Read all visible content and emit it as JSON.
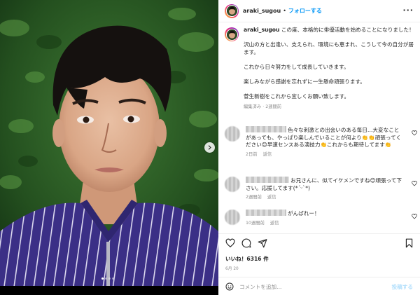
{
  "header": {
    "username": "araki_sugou",
    "separator": "•",
    "follow_label": "フォローする"
  },
  "caption": {
    "username": "araki_sugou",
    "paragraphs": [
      "この度、本格的に俳優活動を始めることになりました！",
      "沢山の方と出逢い、支えられ、環境にも恵まれ、こうして今の自分が居ます。",
      "これから日々努力をして成長していきます。",
      "楽しみながら感謝を忘れずに一生懸命頑張ります。",
      "菅生新樹をこれから宜しくお願い致します。"
    ],
    "meta": "編集済み · 2週間前"
  },
  "comments": [
    {
      "text": "色々な刺激との出会いのある毎日…大変なことがあっても、やっぱり楽しんでいることが何より👏👏頑張ってください😊早速センスある演技力👏これからも期待してます👏",
      "time": "2日前",
      "reply": "返信"
    },
    {
      "text": "お兄さんに、似てイケメンですね😊頑張って下さい。応援してます(*ˊᵕˋ*)",
      "time": "2週間前",
      "reply": "返信"
    },
    {
      "text": "がんばれー！",
      "time": "10週間前",
      "reply": "返信"
    }
  ],
  "actions": {
    "likes": "いいね！6316 件",
    "date": "6月 20",
    "add_comment_placeholder": "コメントを追加...",
    "post_label": "投稿する"
  },
  "carousel": {
    "slide_count": 4,
    "active_index": 0
  },
  "icons": {
    "header": [
      "more-options-icon"
    ],
    "actions": [
      "heart-icon",
      "comment-icon",
      "share-icon",
      "save-icon"
    ],
    "add_comment": [
      "emoji-icon"
    ],
    "photo": [
      "chevron-right-icon"
    ]
  },
  "colors": {
    "link_blue": "#0095f6",
    "post_disabled": "#b2dffc",
    "meta_gray": "#8e8e8e"
  }
}
